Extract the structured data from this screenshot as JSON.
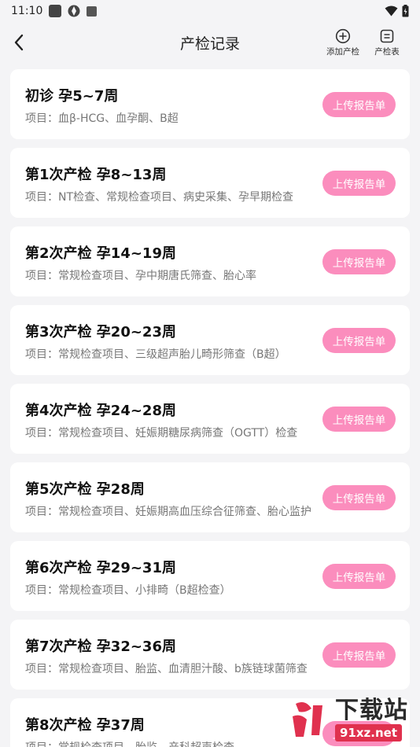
{
  "status_bar": {
    "time": "11:10"
  },
  "header": {
    "title": "产检记录",
    "add_label": "添加产检",
    "table_label": "产检表"
  },
  "records": [
    {
      "title": "初诊 孕5~7周",
      "items": "项目：血β-HCG、血孕酮、B超",
      "button": "上传报告单"
    },
    {
      "title": "第1次产检 孕8~13周",
      "items": "项目：NT检查、常规检查项目、病史采集、孕早期检查",
      "button": "上传报告单"
    },
    {
      "title": "第2次产检 孕14~19周",
      "items": "项目：常规检查项目、孕中期唐氏筛查、胎心率",
      "button": "上传报告单"
    },
    {
      "title": "第3次产检 孕20~23周",
      "items": "项目：常规检查项目、三级超声胎儿畸形筛查（B超）",
      "button": "上传报告单"
    },
    {
      "title": "第4次产检 孕24~28周",
      "items": "项目：常规检查项目、妊娠期糖尿病筛查（OGTT）检查",
      "button": "上传报告单"
    },
    {
      "title": "第5次产检 孕28周",
      "items": "项目：常规检查项目、妊娠期高血压综合征筛查、胎心监护",
      "button": "上传报告单"
    },
    {
      "title": "第6次产检 孕29~31周",
      "items": "项目：常规检查项目、小排畸（B超检查）",
      "button": "上传报告单"
    },
    {
      "title": "第7次产检 孕32~36周",
      "items": "项目：常规检查项目、胎监、血清胆汁酸、b族链球菌筛查",
      "button": "上传报告单"
    },
    {
      "title": "第8次产检 孕37周",
      "items": "项目：常规检查项目、胎监、产科超声检查",
      "button": "上传报告单"
    }
  ],
  "watermark": {
    "text": "下载站",
    "url": "91xz.net"
  },
  "colors": {
    "accent": "#fb8dbd",
    "background": "#f4f4f6",
    "card": "#ffffff"
  }
}
